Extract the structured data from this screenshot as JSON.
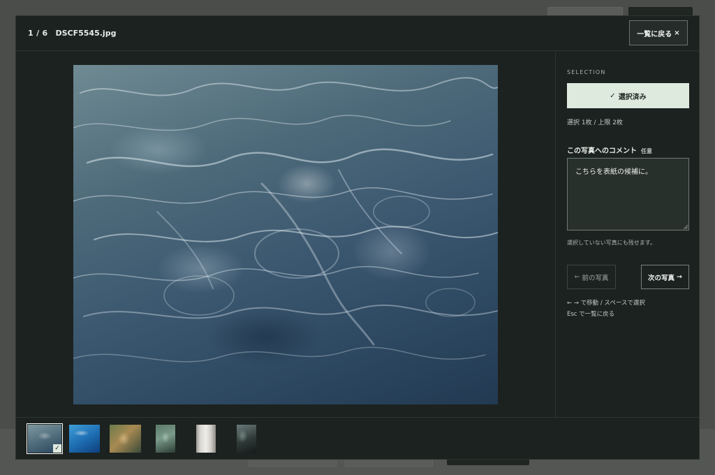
{
  "header": {
    "counter": "1 / 6",
    "filename": "DSCF5545.jpg",
    "back_label": "一覧に戻る",
    "close_glyph": "×"
  },
  "photo": {
    "icon": "photo-water-surface"
  },
  "sidebar": {
    "section_label": "SELECTION",
    "selected_check": "✓",
    "selected_label": "選択済み",
    "count_text": "選択 1枚 / 上限 2枚",
    "comment_title": "この写真へのコメント",
    "comment_optional": "任意",
    "comment_value": "こちらを表紙の候補に。",
    "comment_hint": "選択していない写真にも残せます。",
    "prev_arrow": "←",
    "prev_label": "前の写真",
    "next_label": "次の写真",
    "next_arrow": "→",
    "keyboard_hint_1": "← → で移動 / スペースで選択",
    "keyboard_hint_2": "Esc で一覧に戻る"
  },
  "thumbnails": {
    "active_check": "✓",
    "items": [
      {
        "state": "active",
        "selected": true
      },
      {
        "state": "normal",
        "selected": false
      },
      {
        "state": "normal",
        "selected": false
      },
      {
        "state": "normal",
        "selected": false
      },
      {
        "state": "normal",
        "selected": false
      },
      {
        "state": "normal",
        "selected": false
      }
    ]
  },
  "colors": {
    "accent_selected": "#dfeadf",
    "modal_bg": "#1c2220",
    "overlay": "#4b4d4b"
  }
}
